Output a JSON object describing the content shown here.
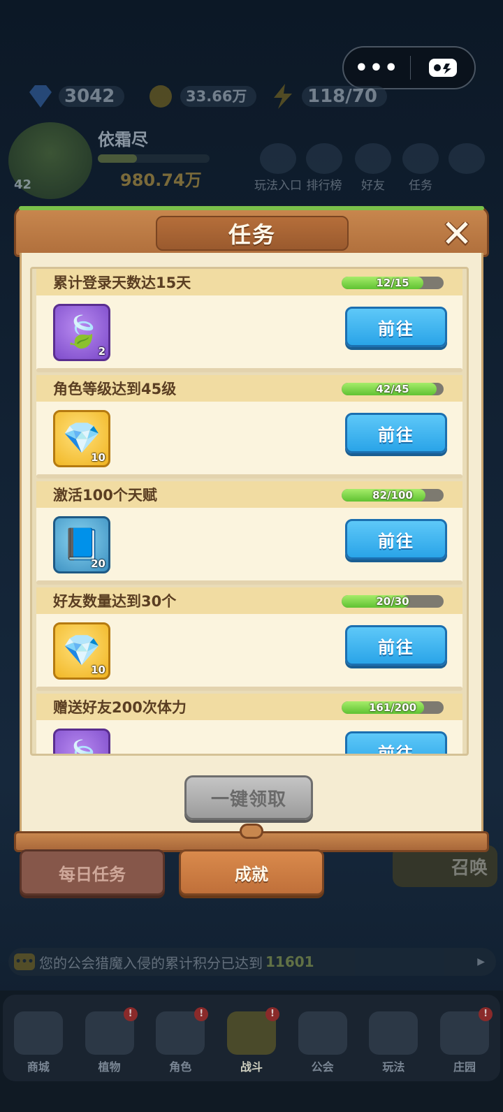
{
  "hud": {
    "diamonds": "3042",
    "coins": "33.66万",
    "stamina": "118/70",
    "player_name": "依霜尽",
    "level": "42",
    "power": "980.74万",
    "more_icon": "ellipsis-icon",
    "pad_icon": "gamepad-icon"
  },
  "top_nav": [
    {
      "label": "玩法入口"
    },
    {
      "label": "排行榜"
    },
    {
      "label": "好友"
    },
    {
      "label": "任务"
    }
  ],
  "modal": {
    "title": "任务",
    "close_glyph": "✕",
    "claim_all_label": "一键领取",
    "tasks": [
      {
        "name": "累计登录天数达15天",
        "progress_text": "12/15",
        "progress": 0.8,
        "reward_icon": "leaf-icon",
        "reward_count": "2",
        "button": "前往"
      },
      {
        "name": "角色等级达到45级",
        "progress_text": "42/45",
        "progress": 0.933,
        "reward_icon": "diamond-icon",
        "reward_count": "10",
        "button": "前往"
      },
      {
        "name": "激活100个天赋",
        "progress_text": "82/100",
        "progress": 0.82,
        "reward_icon": "book-icon",
        "reward_count": "20",
        "button": "前往"
      },
      {
        "name": "好友数量达到30个",
        "progress_text": "20/30",
        "progress": 0.667,
        "reward_icon": "diamond-icon",
        "reward_count": "10",
        "button": "前往"
      },
      {
        "name": "赠送好友200次体力",
        "progress_text": "161/200",
        "progress": 0.805,
        "reward_icon": "leaf-icon",
        "reward_count": "",
        "button": "前往"
      }
    ]
  },
  "tabs": {
    "daily": "每日任务",
    "achievement": "成就"
  },
  "summon_label": "召唤",
  "ticker": {
    "text": "您的公会猎魔入侵的累计积分已达到",
    "value": "11601"
  },
  "bottom_nav": [
    {
      "label": "商城",
      "badge": false
    },
    {
      "label": "植物",
      "badge": true
    },
    {
      "label": "角色",
      "badge": true
    },
    {
      "label": "战斗",
      "badge": true,
      "active": true
    },
    {
      "label": "公会",
      "badge": false
    },
    {
      "label": "玩法",
      "badge": false
    },
    {
      "label": "庄园",
      "badge": true
    }
  ],
  "colors": {
    "go_button": "#2aa4e8",
    "progress_fill": "#5fc232",
    "frame_wood": "#c8874e"
  }
}
